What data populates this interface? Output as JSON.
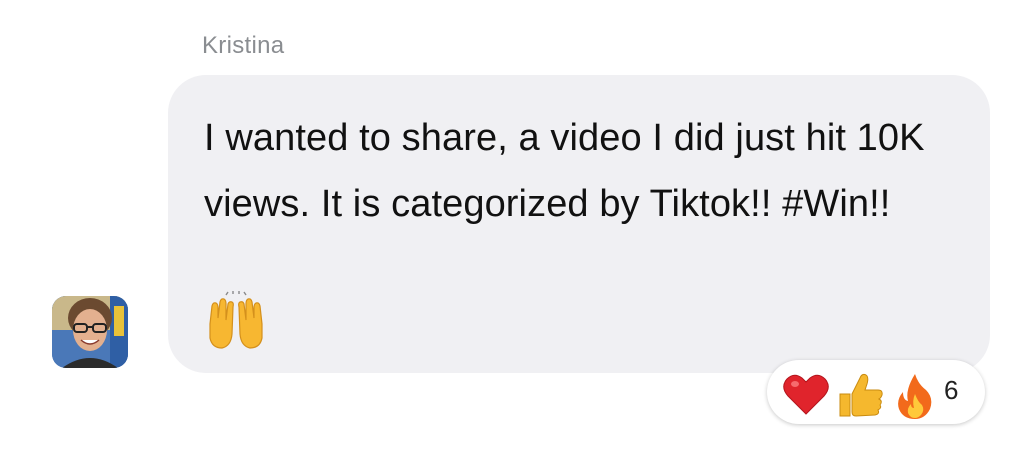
{
  "comment": {
    "author": "Kristina",
    "text": "I wanted to share, a video I did just hit 10K views. It is categorized by Tiktok!! #Win!!",
    "emoji": "raised-hands-icon"
  },
  "reactions": {
    "icons": [
      "heart-icon",
      "thumbs-up-icon",
      "fire-icon"
    ],
    "count": "6"
  },
  "colors": {
    "bubble": "#f0f0f3",
    "author_name": "#8a8d91",
    "heart": "#e0242c",
    "thumbs_up": "#f5b82e",
    "fire": "#f26a1b"
  }
}
